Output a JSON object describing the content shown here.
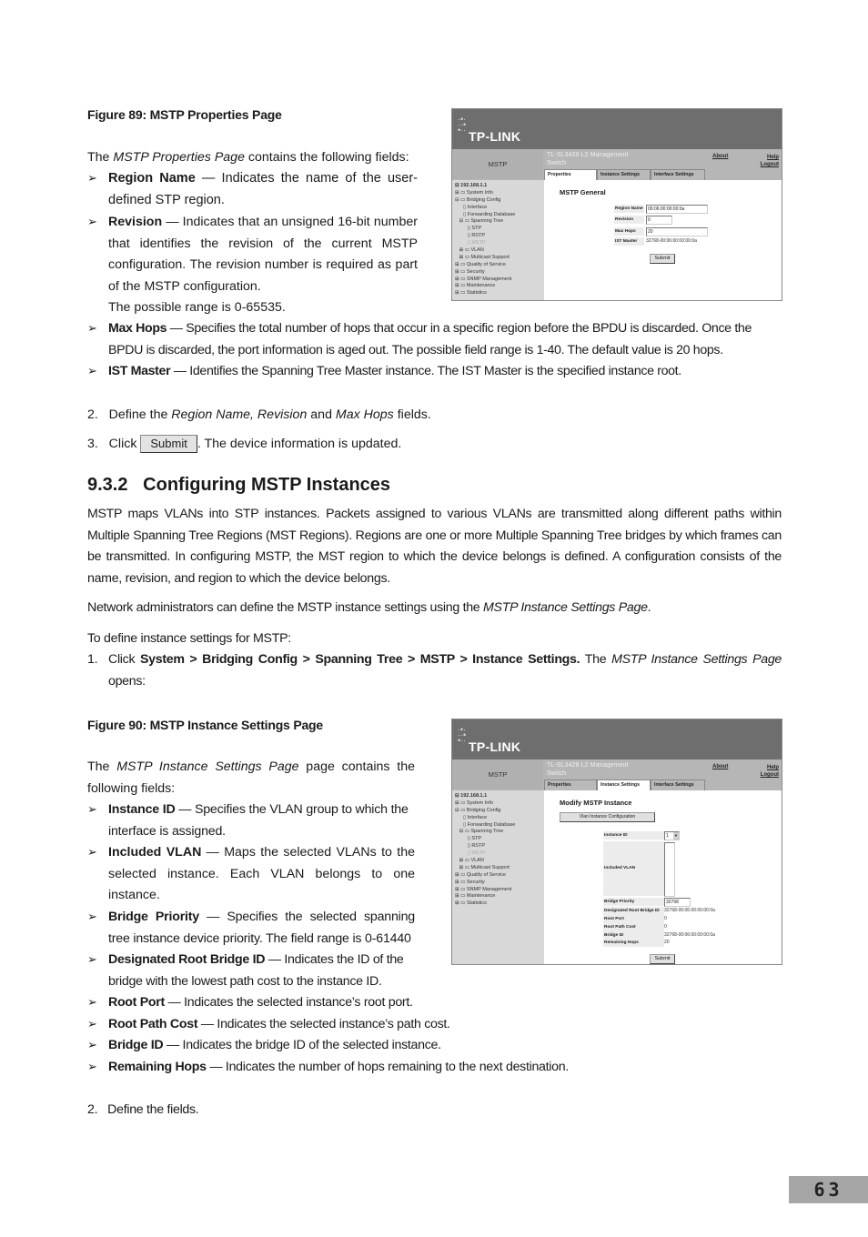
{
  "fig89": {
    "caption": "Figure 89: MSTP Properties Page",
    "intro_pre": "The ",
    "intro_em": "MSTP Properties Page",
    "intro_post": " contains the following fields:",
    "bullets": [
      {
        "term": "Region Name",
        "desc": " — Indicates the name of the user-defined STP region."
      },
      {
        "term": "Revision",
        "desc": " — Indicates that an unsigned 16-bit number that identifies the revision of the current MSTP configuration. The revision number is required as part of the MSTP configuration."
      },
      {
        "term": "Max Hops",
        "desc": " — Specifies the total number of hops that occur in a specific region before the BPDU is discarded. Once the BPDU is discarded, the port information is aged out. The possible field range is 1-40. The default value is 20 hops."
      },
      {
        "term": "IST Master",
        "desc": " — Identifies the Spanning Tree Master instance. The IST Master is the specified instance root."
      }
    ],
    "revision_range": "The possible range is 0-65535."
  },
  "steps1": {
    "step2_num": "2.",
    "step2_pre": "Define the ",
    "step2_em1": "Region Name, Revision",
    "step2_mid": " and ",
    "step2_em2": "Max Hops",
    "step2_post": " fields.",
    "step3_num": "3.",
    "step3_pre": "Click ",
    "step3_button": "Submit",
    "step3_post": ". The device information is updated."
  },
  "section": {
    "heading": "9.3.2   Configuring MSTP Instances",
    "para1": "MSTP maps VLANs into STP instances. Packets assigned to various VLANs are transmitted along different paths within Multiple Spanning Tree Regions (MST Regions). Regions are one or more Multiple Spanning Tree bridges by which frames can be transmitted. In configuring MSTP, the MST region to which the device belongs is defined. A configuration consists of the name, revision, and region to which the device belongs.",
    "para2_pre": "Network administrators can define the MSTP instance settings using the ",
    "para2_em": "MSTP Instance Settings Page",
    "para2_post": ".",
    "para3": "To define instance settings for MSTP:",
    "step1_num": "1.",
    "step1_pre": "Click ",
    "step1_path": "System > Bridging Config > Spanning Tree > MSTP > Instance Settings.",
    "step1_mid": " The ",
    "step1_em": "MSTP Instance Settings Page",
    "step1_post": " opens:"
  },
  "fig90": {
    "caption": "Figure 90: MSTP Instance Settings Page",
    "intro_pre": "The ",
    "intro_em": "MSTP Instance Settings Page",
    "intro_post": " page contains the following fields:",
    "bullets": [
      {
        "term": "Instance ID",
        "desc": " — Specifies the VLAN group to which the interface is assigned."
      },
      {
        "term": "Included VLAN",
        "desc": " — Maps the selected VLANs to the selected instance. Each VLAN belongs to one instance."
      },
      {
        "term": "Bridge Priority",
        "desc": " — Specifies the selected spanning tree instance device priority. The field range is 0-61440"
      },
      {
        "term": "Designated Root Bridge ID",
        "desc": " — Indicates the ID of the bridge with the lowest path cost to the instance ID."
      },
      {
        "term": "Root Port",
        "desc": " — Indicates the selected instance’s root port."
      },
      {
        "term": "Root Path Cost",
        "desc": " — Indicates the selected instance’s path cost."
      },
      {
        "term": "Bridge ID",
        "desc": " — Indicates the bridge ID of the selected instance."
      },
      {
        "term": "Remaining Hops",
        "desc": " — Indicates the number of hops remaining to the next destination."
      }
    ]
  },
  "steps2": {
    "step2_num": "2.",
    "step2_text": "Define the fields."
  },
  "page_number": "63",
  "screens": {
    "logo": "TP-LINK",
    "module": "MSTP",
    "product_line1": "TL-SL3428 L2 Management",
    "product_line2": "Switch",
    "about": "About",
    "help": "Help",
    "logout": "Logout",
    "tabs": [
      "Properties",
      "Instance Settings",
      "Interface Settings"
    ],
    "tree": [
      {
        "prefix": "⊟ ",
        "label": "192.168.1.1",
        "bold": true
      },
      {
        "prefix": "⊞ ▭ ",
        "label": "System Info"
      },
      {
        "prefix": "⊟ ▭ ",
        "label": "Bridging Config"
      },
      {
        "prefix": "      ▯ ",
        "label": "Interface"
      },
      {
        "prefix": "      ▯ ",
        "label": "Forwarding Database"
      },
      {
        "prefix": "   ⊟ ▭ ",
        "label": "Spanning Tree"
      },
      {
        "prefix": "         ▯ ",
        "label": "STP"
      },
      {
        "prefix": "         ▯ ",
        "label": "RSTP"
      },
      {
        "prefix": "         ▯ ",
        "label": "MSTP",
        "dim": true
      },
      {
        "prefix": "   ⊞ ▭ ",
        "label": "VLAN"
      },
      {
        "prefix": "   ⊞ ▭ ",
        "label": "Multicast Support"
      },
      {
        "prefix": "⊞ ▭ ",
        "label": "Quality of Service"
      },
      {
        "prefix": "⊞ ▭ ",
        "label": "Security"
      },
      {
        "prefix": "⊞ ▭ ",
        "label": "SNMP Management"
      },
      {
        "prefix": "⊞ ▭ ",
        "label": "Maintenance"
      },
      {
        "prefix": "⊞ ▭ ",
        "label": "Statistics"
      }
    ],
    "props": {
      "title": "MSTP General",
      "region_name_label": "Region Name",
      "region_name_value": "00:06:00:00:00:0a",
      "revision_label": "Revision",
      "revision_value": "0",
      "max_hops_label": "Max Hops",
      "max_hops_value": "20",
      "ist_master_label": "IST Master",
      "ist_master_value": "32768-00:06:00:00:00:0a",
      "submit": "Submit"
    },
    "instance": {
      "title": "Modify MSTP Instance",
      "vlan_config_button": "Vlan Instance Configuration",
      "instance_id_label": "Instance ID",
      "instance_id_value": "1",
      "included_vlan_label": "Included VLAN",
      "bridge_priority_label": "Bridge Priority",
      "bridge_priority_value": "32768",
      "designated_root_label": "Designated Root Bridge ID",
      "designated_root_value": "32768-00:06:00:00:00:0a",
      "root_port_label": "Root Port",
      "root_port_value": "0",
      "root_path_cost_label": "Root Path Cost",
      "root_path_cost_value": "0",
      "bridge_id_label": "Bridge ID",
      "bridge_id_value": "32768-00:06:00:00:00:0a",
      "remaining_hops_label": "Remaining Hops",
      "remaining_hops_value": "20",
      "submit": "Submit"
    }
  }
}
